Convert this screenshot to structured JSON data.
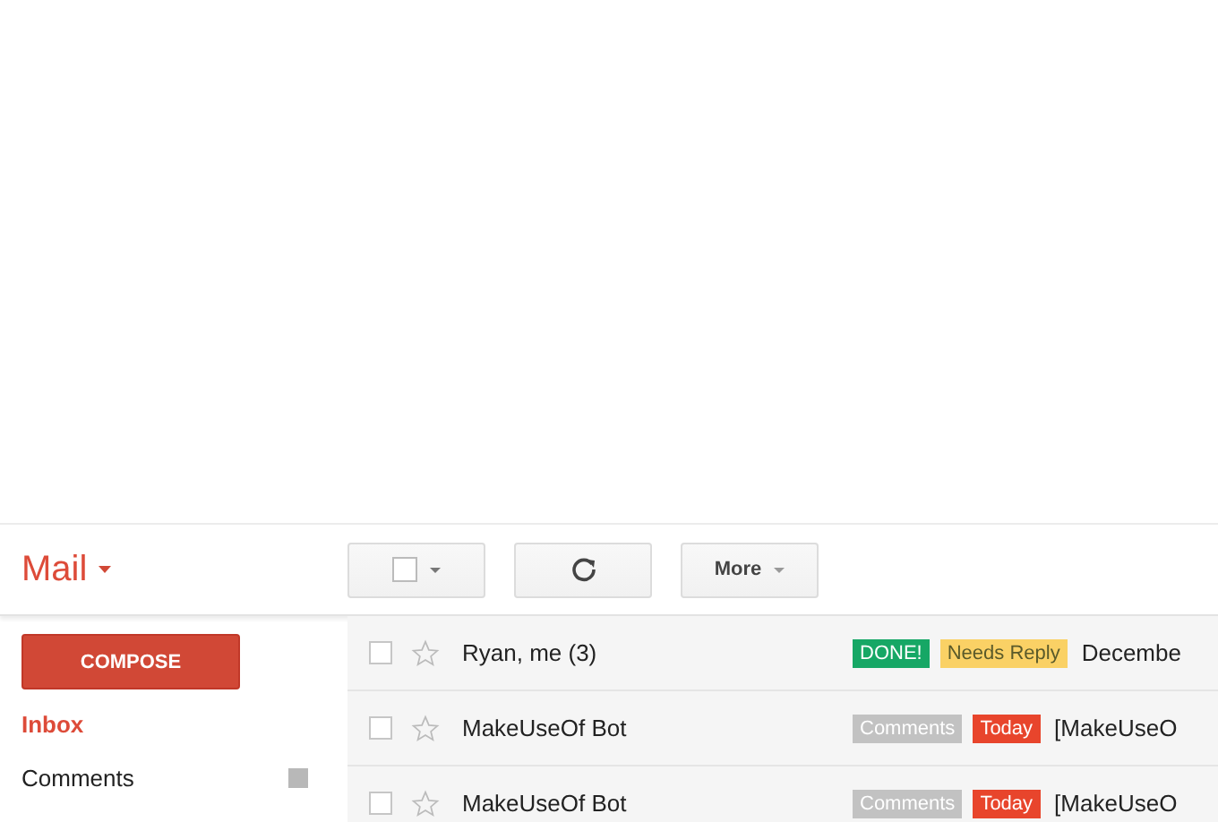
{
  "app": {
    "title": "Mail"
  },
  "toolbar": {
    "more_label": "More"
  },
  "sidebar": {
    "compose": "COMPOSE",
    "items": [
      {
        "label": "Inbox",
        "selected": true
      },
      {
        "label": "Comments",
        "selected": false,
        "color": "#b8b8b8"
      }
    ]
  },
  "messages": [
    {
      "sender": "Ryan, me (3)",
      "checked": false,
      "starred": false,
      "labels": [
        {
          "text": "DONE!",
          "color": "#16a765"
        },
        {
          "text": "Needs Reply",
          "color": "#fad165"
        }
      ],
      "subject": "Decembe"
    },
    {
      "sender": "MakeUseOf Bot",
      "checked": false,
      "starred": false,
      "labels": [
        {
          "text": "Comments",
          "color": "#c2c2c2"
        },
        {
          "text": "Today",
          "color": "#e8452c"
        }
      ],
      "subject": "[MakeUseO"
    },
    {
      "sender": "MakeUseOf Bot",
      "checked": false,
      "starred": false,
      "labels": [
        {
          "text": "Comments",
          "color": "#c2c2c2"
        },
        {
          "text": "Today",
          "color": "#e8452c"
        }
      ],
      "subject": "[MakeUseO"
    }
  ]
}
